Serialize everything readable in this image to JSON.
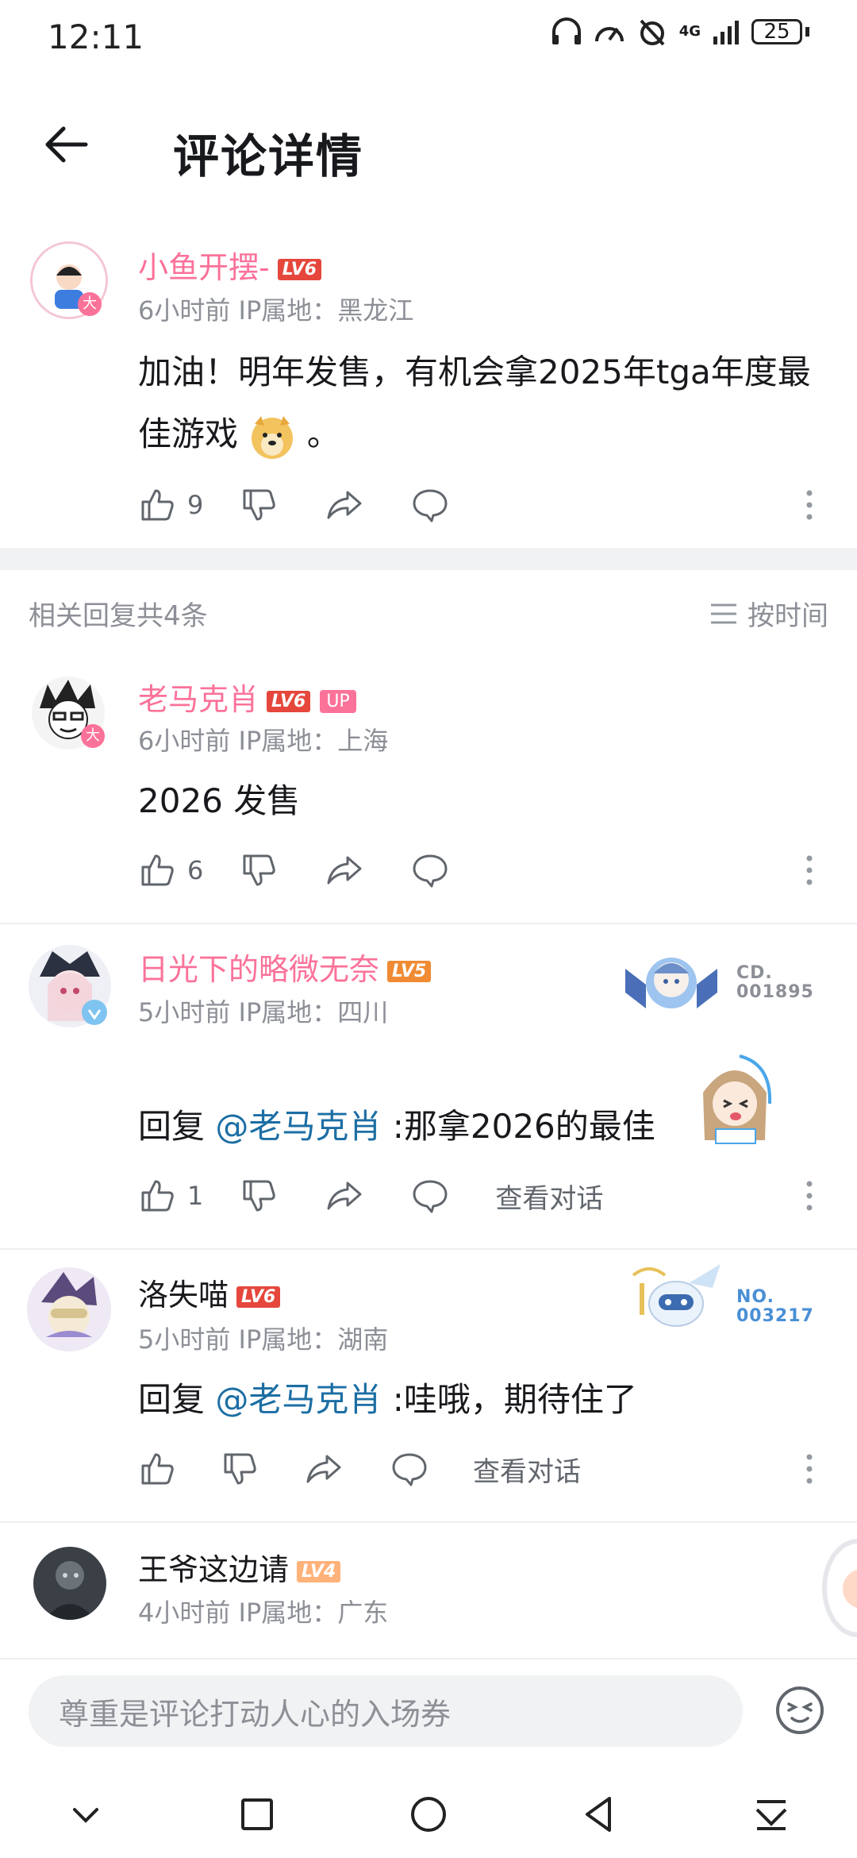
{
  "status": {
    "time": "12:11",
    "network": "4G",
    "battery": "25"
  },
  "header": {
    "title": "评论详情"
  },
  "main_comment": {
    "username": "小鱼开摆-",
    "level": "LV6",
    "time": "6小时前",
    "ip_label": "IP属地：黑龙江",
    "text": "加油！明年发售，有机会拿2025年tga年度最佳游戏",
    "text_tail": "。",
    "likes": "9"
  },
  "replies_header": {
    "count_label": "相关回复共4条",
    "sort_label": "按时间"
  },
  "replies": [
    {
      "username": "老马克肖",
      "level": "LV6",
      "up_badge": "UP",
      "time": "6小时前",
      "ip_label": "IP属地：上海",
      "text": "2026 发售",
      "likes": "6"
    },
    {
      "username": "日光下的略微无奈",
      "level": "LV5",
      "time": "5小时前",
      "ip_label": "IP属地：四川",
      "reply_prefix": "回复 ",
      "mention": "@老马克肖",
      "text": " :那拿2026的最佳",
      "likes": "1",
      "view_conv": "查看对话",
      "badge_no_line1": "CD.",
      "badge_no_line2": "001895"
    },
    {
      "username": "洛失喵",
      "level": "LV6",
      "time": "5小时前",
      "ip_label": "IP属地：湖南",
      "reply_prefix": "回复 ",
      "mention": "@老马克肖",
      "text": " :哇哦，期待住了",
      "view_conv": "查看对话",
      "badge_no_line1": "NO.",
      "badge_no_line2": "003217"
    },
    {
      "username": "王爷这边请",
      "level": "LV4",
      "time": "4小时前",
      "ip_label": "IP属地：广东"
    }
  ],
  "input": {
    "placeholder": "尊重是评论打动人心的入场券"
  },
  "colors": {
    "accent_pink": "#fb7299",
    "mention_blue": "#1c6ea4",
    "meta_gray": "#8c8f96"
  }
}
